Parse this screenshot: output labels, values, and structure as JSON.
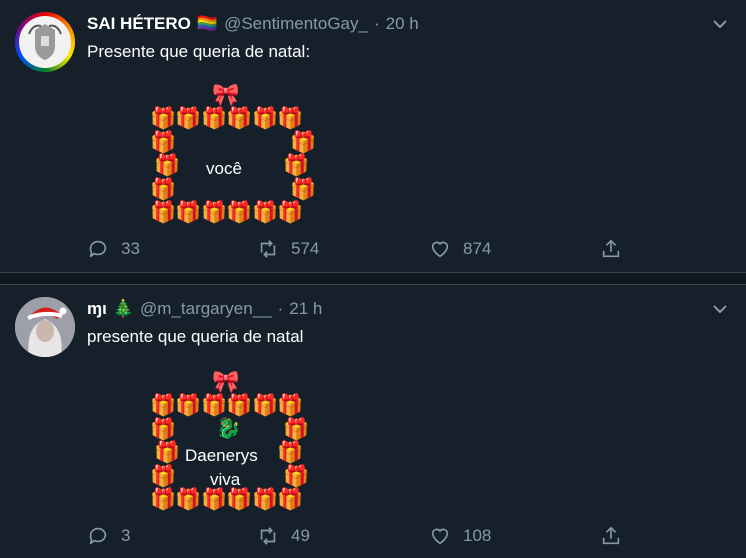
{
  "tweets": [
    {
      "name": "SAI HÉTERO",
      "name_badge": "🏳️‍🌈",
      "handle": "@SentimentoGay_",
      "separator": "·",
      "time": "20 h",
      "text": "Presente que queria de natal:",
      "frame": {
        "bow": "🎀",
        "gift": "🎁",
        "label": "você"
      },
      "counts": {
        "replies": "33",
        "retweets": "574",
        "likes": "874"
      }
    },
    {
      "name": "ɱι",
      "name_badge": "🎄",
      "handle": "@m_targaryen__",
      "separator": "·",
      "time": "21 h",
      "text": "presente que queria de natal",
      "frame": {
        "bow": "🎀",
        "gift": "🎁",
        "dragon": "🐉",
        "label_line1": "Daenerys",
        "label_line2": "viva"
      },
      "counts": {
        "replies": "3",
        "retweets": "49",
        "likes": "108"
      }
    }
  ],
  "colors": {
    "background": "#15202b",
    "secondary_text": "#8899a6",
    "divider": "#10171e"
  }
}
